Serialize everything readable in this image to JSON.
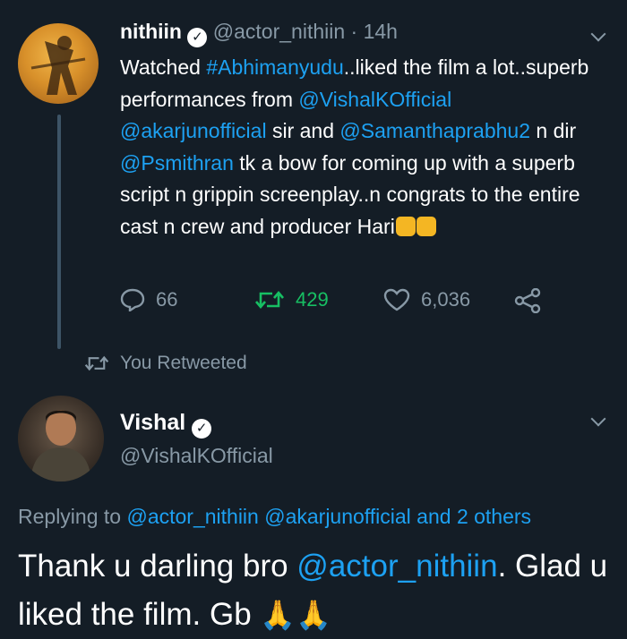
{
  "tweet1": {
    "display_name": "nithiin",
    "handle": "@actor_nithiin",
    "separator": "·",
    "time": "14h",
    "text_parts": {
      "p1": "Watched ",
      "hashtag": "#Abhimanyudu",
      "p2": "..liked the film a lot..superb performances from ",
      "mention1": "@VishalKOfficial",
      "p3": " ",
      "mention2": "@akarjunofficial",
      "p4": " sir and ",
      "mention3": "@Samanthaprabhu2",
      "p5": " n dir ",
      "mention4": "@Psmithran",
      "p6": " tk a bow for coming up with a superb script n grippin screenplay..n congrats to the entire cast n crew and producer Hari"
    },
    "emoji": [
      "thumbs-up",
      "thumbs-up"
    ],
    "replies_count": "66",
    "retweets_count": "429",
    "likes_count": "6,036"
  },
  "retweet_notice": "You Retweeted",
  "tweet2": {
    "display_name": "Vishal",
    "handle": "@VishalKOfficial",
    "replying_prefix": "Replying to ",
    "replying_to": "@actor_nithiin @akarjunofficial and 2 others",
    "text_p1": "Thank u darling bro ",
    "text_mention": "@actor_nithiin",
    "text_p2": ". Glad u liked the film. Gb ",
    "emoji": [
      "folded-hands",
      "folded-hands"
    ]
  },
  "colors": {
    "background": "#141d26",
    "link": "#1da1f2",
    "muted": "#8899a6",
    "retweet_active": "#17bf63"
  }
}
